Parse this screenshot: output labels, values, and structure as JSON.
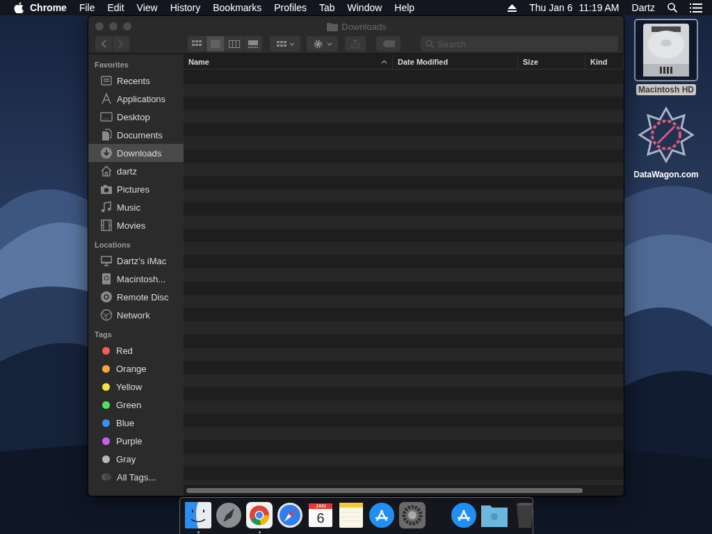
{
  "menu_bar": {
    "app": "Chrome",
    "menus": [
      "File",
      "Edit",
      "View",
      "History",
      "Bookmarks",
      "Profiles",
      "Tab",
      "Window",
      "Help"
    ],
    "date": "Thu Jan 6",
    "time": "11:19 AM",
    "user": "Dartz"
  },
  "window": {
    "title": "Downloads",
    "search": {
      "placeholder": "Search"
    },
    "view_modes": [
      {
        "kind": "icons",
        "selected": false
      },
      {
        "kind": "list",
        "selected": true
      },
      {
        "kind": "columns",
        "selected": false
      },
      {
        "kind": "gallery",
        "selected": false
      }
    ],
    "columns": [
      {
        "label": "Name",
        "sorted": true
      },
      {
        "label": "Date Modified",
        "sorted": false
      },
      {
        "label": "Size",
        "sorted": false
      },
      {
        "label": "Kind",
        "sorted": false
      }
    ]
  },
  "sidebar": {
    "sections": [
      {
        "title": "Favorites",
        "items": [
          {
            "label": "Recents",
            "kind": "recents",
            "selected": false
          },
          {
            "label": "Applications",
            "kind": "applications",
            "selected": false
          },
          {
            "label": "Desktop",
            "kind": "desktop",
            "selected": false
          },
          {
            "label": "Documents",
            "kind": "documents",
            "selected": false
          },
          {
            "label": "Downloads",
            "kind": "downloads",
            "selected": true
          },
          {
            "label": "dartz",
            "kind": "home",
            "selected": false
          },
          {
            "label": "Pictures",
            "kind": "pictures",
            "selected": false
          },
          {
            "label": "Music",
            "kind": "music",
            "selected": false
          },
          {
            "label": "Movies",
            "kind": "movies",
            "selected": false
          }
        ]
      },
      {
        "title": "Locations",
        "items": [
          {
            "label": "Dartz’s iMac",
            "kind": "computer",
            "selected": false
          },
          {
            "label": "Macintosh...",
            "kind": "disk",
            "selected": false
          },
          {
            "label": "Remote Disc",
            "kind": "disc",
            "selected": false
          },
          {
            "label": "Network",
            "kind": "network",
            "selected": false
          }
        ]
      },
      {
        "title": "Tags",
        "items": [
          {
            "label": "Red",
            "kind": "tag",
            "color": "#f25c5c",
            "selected": false
          },
          {
            "label": "Orange",
            "kind": "tag",
            "color": "#f6a93b",
            "selected": false
          },
          {
            "label": "Yellow",
            "kind": "tag",
            "color": "#f5e33b",
            "selected": false
          },
          {
            "label": "Green",
            "kind": "tag",
            "color": "#52e05a",
            "selected": false
          },
          {
            "label": "Blue",
            "kind": "tag",
            "color": "#3d8ef0",
            "selected": false
          },
          {
            "label": "Purple",
            "kind": "tag",
            "color": "#c462ee",
            "selected": false
          },
          {
            "label": "Gray",
            "kind": "tag",
            "color": "#b8b8b8",
            "selected": false
          },
          {
            "label": "All Tags...",
            "kind": "alltags",
            "selected": false
          }
        ]
      }
    ]
  },
  "desktop_icons": [
    {
      "label": "Macintosh HD",
      "kind": "drive",
      "selected": true
    },
    {
      "label": "DataWagon.com",
      "kind": "logo",
      "selected": false
    }
  ],
  "dock": {
    "items": [
      {
        "kind": "finder",
        "running": true
      },
      {
        "kind": "launchpad",
        "running": false
      },
      {
        "kind": "chrome",
        "running": true
      },
      {
        "kind": "safari",
        "running": false
      },
      {
        "kind": "calendar",
        "month": "JAN",
        "day": "6",
        "running": false
      },
      {
        "kind": "notes",
        "running": false
      },
      {
        "kind": "appstore",
        "running": false
      },
      {
        "kind": "preferences",
        "running": false
      },
      {
        "kind": "separator"
      },
      {
        "kind": "appstore",
        "running": false
      },
      {
        "kind": "folder",
        "running": false
      },
      {
        "kind": "trash",
        "running": false
      }
    ]
  }
}
